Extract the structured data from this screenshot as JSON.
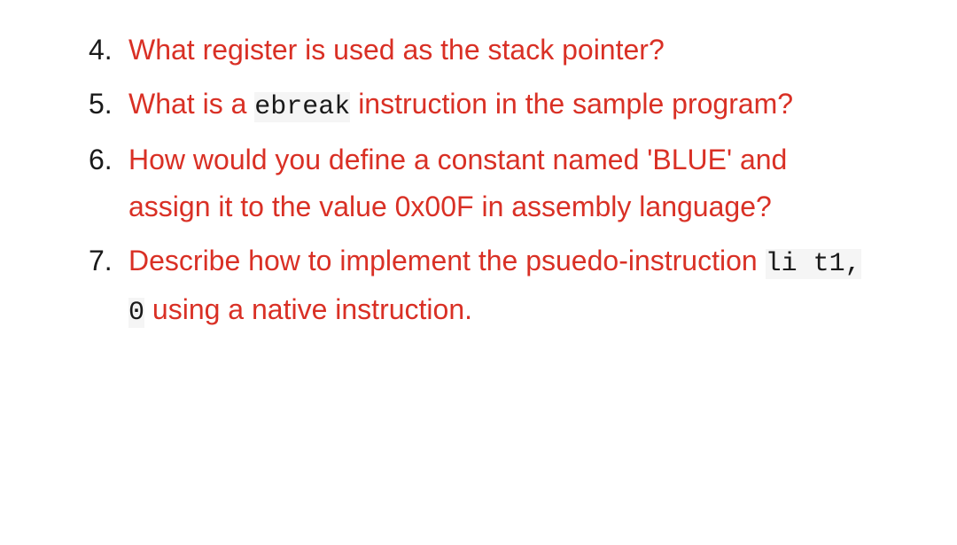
{
  "questions": {
    "q4": {
      "text": "What register is used as the stack pointer?"
    },
    "q5": {
      "part1": "What is a ",
      "code": "ebreak",
      "part2": " instruction in the sample program?"
    },
    "q6": {
      "text": "How would you define a constant named 'BLUE' and assign it to the value 0x00F in assembly language?"
    },
    "q7": {
      "part1": "Describe how to implement the psuedo-instruction ",
      "code": "li t1, 0",
      "part2": " using a native instruction."
    }
  }
}
